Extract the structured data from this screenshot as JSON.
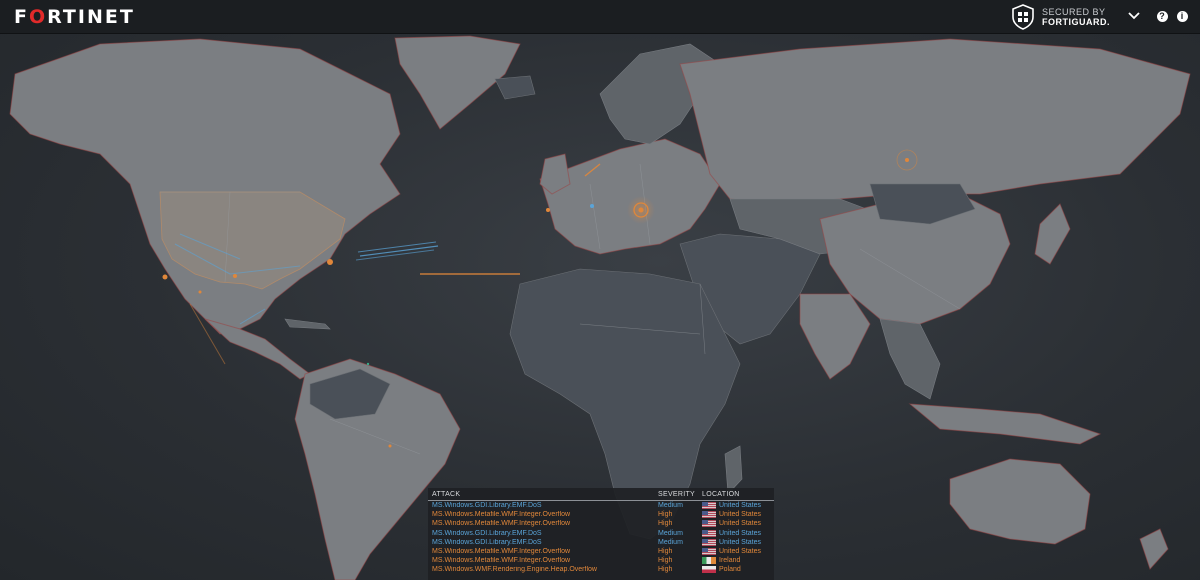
{
  "header": {
    "brand": "FORTINET",
    "secured_top": "SECURED BY",
    "secured_bottom": "FORTIGUARD.",
    "help_glyph": "?",
    "info_glyph": "i",
    "icons": {
      "shield": "fortiguard-shield-icon",
      "menu": "chevron-down-icon",
      "help": "help-icon",
      "info": "info-icon"
    }
  },
  "colors": {
    "header_bg": "#1b1e21",
    "brand_red": "#e12a2a",
    "attack_blue": "#5aa4d8",
    "attack_orange": "#e0873a",
    "land": "#7b7e82",
    "dark_region": "#4a5058"
  },
  "attacks": {
    "headers": {
      "attack": "ATTACK",
      "severity": "SEVERITY",
      "location": "LOCATION"
    },
    "rows": [
      {
        "attack": "MS.Windows.GDI.Library.EMF.DoS",
        "severity": "Medium",
        "location": "United States",
        "flag": "us",
        "color": "blue"
      },
      {
        "attack": "MS.Windows.Metafile.WMF.Integer.Overflow",
        "severity": "High",
        "location": "United States",
        "flag": "us",
        "color": "orange"
      },
      {
        "attack": "MS.Windows.Metafile.WMF.Integer.Overflow",
        "severity": "High",
        "location": "United States",
        "flag": "us",
        "color": "orange"
      },
      {
        "attack": "MS.Windows.GDI.Library.EMF.DoS",
        "severity": "Medium",
        "location": "United States",
        "flag": "us",
        "color": "blue"
      },
      {
        "attack": "MS.Windows.GDI.Library.EMF.DoS",
        "severity": "Medium",
        "location": "United States",
        "flag": "us",
        "color": "blue"
      },
      {
        "attack": "MS.Windows.Metafile.WMF.Integer.Overflow",
        "severity": "High",
        "location": "United States",
        "flag": "us",
        "color": "orange"
      },
      {
        "attack": "MS.Windows.Metafile.WMF.Integer.Overflow",
        "severity": "High",
        "location": "Ireland",
        "flag": "ie",
        "color": "orange"
      },
      {
        "attack": "MS.Windows.WMF.Rendering.Engine.Heap.Overflow",
        "severity": "High",
        "location": "Poland",
        "flag": "pl",
        "color": "orange"
      }
    ]
  }
}
